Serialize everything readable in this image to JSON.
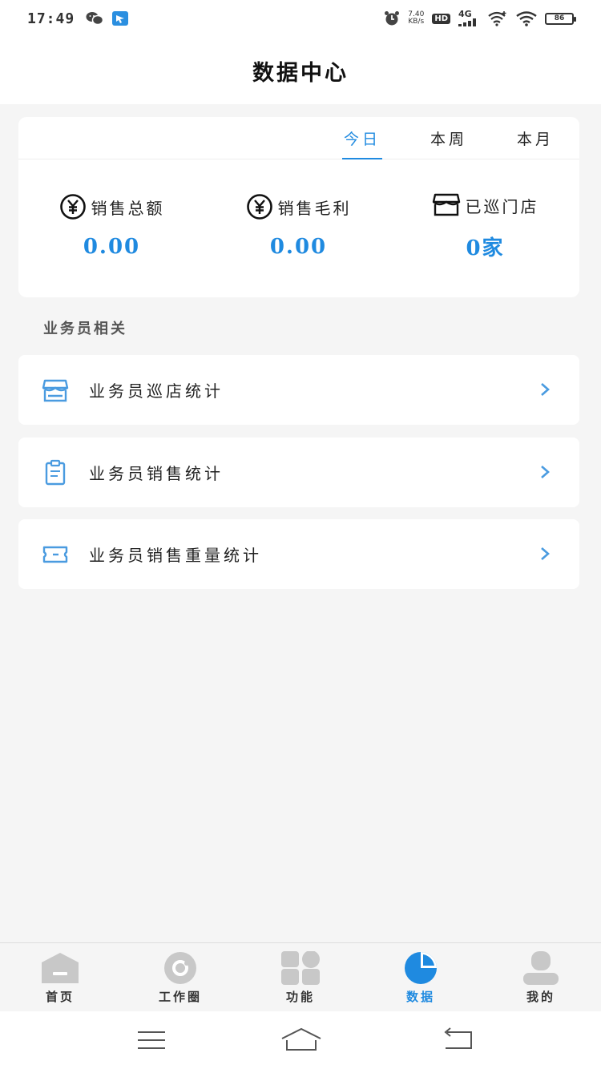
{
  "status_bar": {
    "time": "17:49",
    "speed_value": "7.40",
    "speed_unit": "KB/s",
    "hd": "HD",
    "network": "4G",
    "battery": "86"
  },
  "header": {
    "title": "数据中心"
  },
  "period_tabs": [
    {
      "label": "今日",
      "active": true
    },
    {
      "label": "本周",
      "active": false
    },
    {
      "label": "本月",
      "active": false
    }
  ],
  "stats": [
    {
      "icon": "yen-circle-icon",
      "label": "销售总额",
      "value": "0.00"
    },
    {
      "icon": "yen-circle-icon",
      "label": "销售毛利",
      "value": "0.00"
    },
    {
      "icon": "store-icon",
      "label": "已巡门店",
      "value": "0家"
    }
  ],
  "section": {
    "title": "业务员相关"
  },
  "list_items": [
    {
      "icon": "store-icon",
      "label": "业务员巡店统计"
    },
    {
      "icon": "clipboard-icon",
      "label": "业务员销售统计"
    },
    {
      "icon": "ticket-icon",
      "label": "业务员销售重量统计"
    }
  ],
  "bottom_tabs": [
    {
      "icon": "home-icon",
      "label": "首页",
      "active": false
    },
    {
      "icon": "circle-icon",
      "label": "工作圈",
      "active": false
    },
    {
      "icon": "grid-icon",
      "label": "功能",
      "active": false
    },
    {
      "icon": "pie-chart-icon",
      "label": "数据",
      "active": true
    },
    {
      "icon": "user-icon",
      "label": "我的",
      "active": false
    }
  ],
  "colors": {
    "accent": "#1f8ae0",
    "icon_gray": "#c8c8c8",
    "background": "#f5f5f5"
  }
}
